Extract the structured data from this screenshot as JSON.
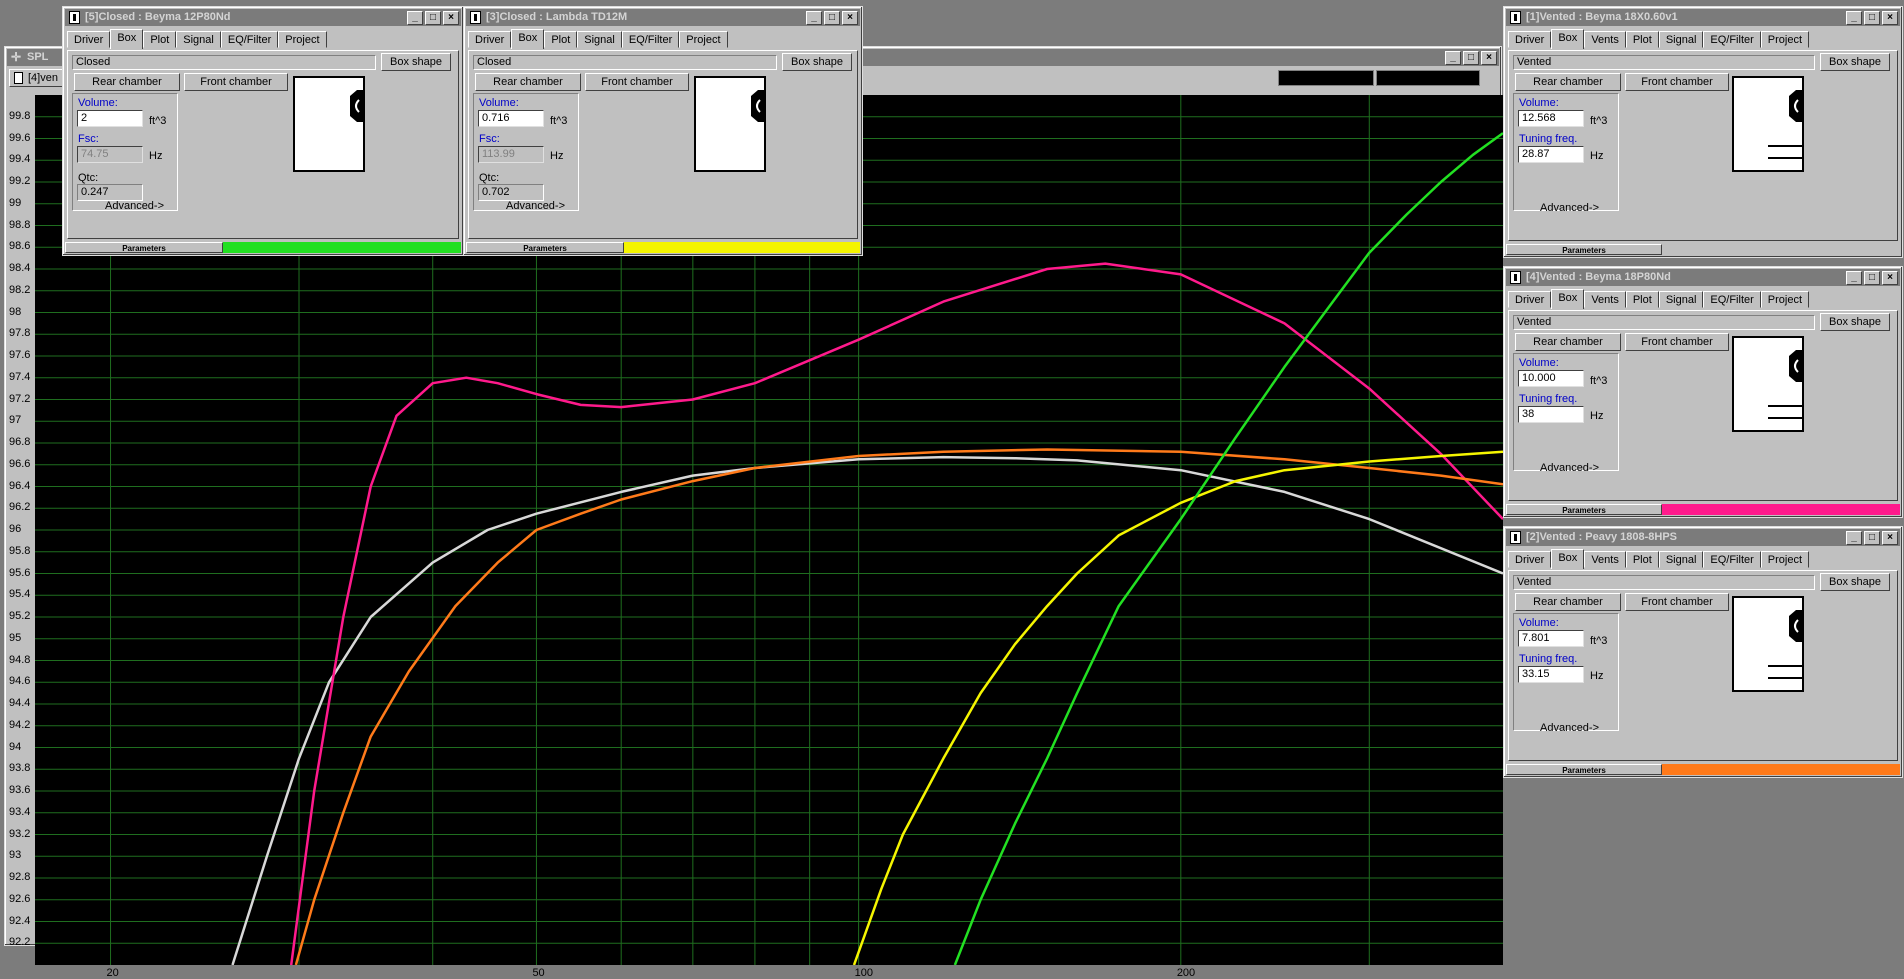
{
  "spl_window": {
    "title": "SPL",
    "tab_label": "[4]ven",
    "window_buttons": [
      "_",
      "□",
      "×"
    ]
  },
  "driver_windows": [
    {
      "id": "w5",
      "title": "[5]Closed : Beyma 12P80Nd",
      "tabs": [
        "Driver",
        "Box",
        "Plot",
        "Signal",
        "EQ/Filter",
        "Project"
      ],
      "active_tab": "Box",
      "box_type": "Closed",
      "box_shape_label": "Box shape",
      "rear_label": "Rear chamber",
      "front_label": "Front chamber",
      "volume_label": "Volume:",
      "volume": "2",
      "volume_unit": "ft^3",
      "f2_label": "Fsc:",
      "f2": "74.75",
      "f2_unit": "Hz",
      "q_label": "Qtc:",
      "q": "0.247",
      "advanced": "Advanced->",
      "status": "Parameters",
      "color": "#22e022"
    },
    {
      "id": "w3",
      "title": "[3]Closed : Lambda TD12M",
      "tabs": [
        "Driver",
        "Box",
        "Plot",
        "Signal",
        "EQ/Filter",
        "Project"
      ],
      "active_tab": "Box",
      "box_type": "Closed",
      "box_shape_label": "Box shape",
      "rear_label": "Rear chamber",
      "front_label": "Front chamber",
      "volume_label": "Volume:",
      "volume": "0.716",
      "volume_unit": "ft^3",
      "f2_label": "Fsc:",
      "f2": "113.99",
      "f2_unit": "Hz",
      "q_label": "Qtc:",
      "q": "0.702",
      "advanced": "Advanced->",
      "status": "Parameters",
      "color": "#f5f500"
    },
    {
      "id": "w1",
      "title": "[1]Vented : Beyma 18X0.60v1",
      "tabs": [
        "Driver",
        "Box",
        "Vents",
        "Plot",
        "Signal",
        "EQ/Filter",
        "Project"
      ],
      "active_tab": "Box",
      "box_type": "Vented",
      "box_shape_label": "Box shape",
      "rear_label": "Rear chamber",
      "front_label": "Front chamber",
      "volume_label": "Volume:",
      "volume": "12.568",
      "volume_unit": "ft^3",
      "f2_label": "Tuning freq.",
      "f2": "28.87",
      "f2_unit": "Hz",
      "advanced": "Advanced->",
      "status": "Parameters",
      "color": "#c0c0c0"
    },
    {
      "id": "w4",
      "title": "[4]Vented : Beyma 18P80Nd",
      "tabs": [
        "Driver",
        "Box",
        "Vents",
        "Plot",
        "Signal",
        "EQ/Filter",
        "Project"
      ],
      "active_tab": "Box",
      "box_type": "Vented",
      "box_shape_label": "Box shape",
      "rear_label": "Rear chamber",
      "front_label": "Front chamber",
      "volume_label": "Volume:",
      "volume": "10.000",
      "volume_unit": "ft^3",
      "f2_label": "Tuning freq.",
      "f2": "38",
      "f2_unit": "Hz",
      "advanced": "Advanced->",
      "status": "Parameters",
      "color": "#ff1a8c"
    },
    {
      "id": "w2",
      "title": "[2]Vented : Peavy 1808-8HPS",
      "tabs": [
        "Driver",
        "Box",
        "Vents",
        "Plot",
        "Signal",
        "EQ/Filter",
        "Project"
      ],
      "active_tab": "Box",
      "box_type": "Vented",
      "box_shape_label": "Box shape",
      "rear_label": "Rear chamber",
      "front_label": "Front chamber",
      "volume_label": "Volume:",
      "volume": "7.801",
      "volume_unit": "ft^3",
      "f2_label": "Tuning freq.",
      "f2": "33.15",
      "f2_unit": "Hz",
      "advanced": "Advanced->",
      "status": "Parameters",
      "color": "#ff7a1a"
    }
  ],
  "chart_data": {
    "type": "line",
    "x_scale": "log",
    "xlim": [
      17,
      400
    ],
    "ylim": [
      92.0,
      100.0
    ],
    "x_tick_labels": [
      20,
      50,
      100,
      200
    ],
    "y_tick_labels": [
      "99.8",
      "99.6",
      "99.4",
      "99.2",
      "99",
      "98.8",
      "98.6",
      "98.4",
      "98.2",
      "98",
      "97.8",
      "97.6",
      "97.4",
      "97.2",
      "97",
      "96.8",
      "96.6",
      "96.4",
      "96.2",
      "96",
      "95.8",
      "95.6",
      "95.4",
      "95.2",
      "95",
      "94.8",
      "94.6",
      "94.4",
      "94.2",
      "94",
      "93.8",
      "93.6",
      "93.4",
      "93.2",
      "93",
      "92.8",
      "92.6",
      "92.4",
      "92.2"
    ],
    "grid": true,
    "background": "#000000",
    "grid_color": "#1f6e1f",
    "series": [
      {
        "color": "#d8d8d8",
        "x": [
          26,
          28,
          30,
          32,
          35,
          40,
          45,
          50,
          60,
          70,
          80,
          100,
          120,
          140,
          160,
          200,
          250,
          300,
          400
        ],
        "y": [
          92.0,
          93.0,
          93.9,
          94.6,
          95.2,
          95.7,
          96.0,
          96.15,
          96.35,
          96.5,
          96.57,
          96.65,
          96.67,
          96.66,
          96.64,
          96.55,
          96.35,
          96.1,
          95.6
        ]
      },
      {
        "color": "#ff1a8c",
        "x": [
          29.5,
          31,
          33,
          35,
          37,
          40,
          43,
          46,
          50,
          55,
          60,
          70,
          80,
          100,
          120,
          150,
          170,
          200,
          250,
          300,
          350,
          400
        ],
        "y": [
          92.0,
          93.6,
          95.2,
          96.4,
          97.05,
          97.35,
          97.4,
          97.35,
          97.25,
          97.15,
          97.13,
          97.2,
          97.35,
          97.75,
          98.1,
          98.4,
          98.45,
          98.35,
          97.9,
          97.3,
          96.7,
          96.1
        ]
      },
      {
        "color": "#ff7a1a",
        "x": [
          29.8,
          31,
          33,
          35,
          38,
          42,
          46,
          50,
          55,
          60,
          70,
          80,
          100,
          120,
          150,
          200,
          250,
          300,
          350,
          400
        ],
        "y": [
          92.0,
          92.6,
          93.4,
          94.1,
          94.7,
          95.3,
          95.7,
          96.0,
          96.15,
          96.28,
          96.45,
          96.57,
          96.68,
          96.72,
          96.74,
          96.72,
          96.65,
          96.57,
          96.5,
          96.42
        ]
      },
      {
        "color": "#f5f500",
        "x": [
          99,
          105,
          110,
          120,
          130,
          140,
          150,
          160,
          175,
          200,
          225,
          250,
          300,
          350,
          400
        ],
        "y": [
          92.0,
          92.7,
          93.2,
          93.9,
          94.5,
          94.95,
          95.3,
          95.6,
          95.95,
          96.25,
          96.45,
          96.55,
          96.63,
          96.68,
          96.72
        ]
      },
      {
        "color": "#22e022",
        "x": [
          123,
          130,
          140,
          150,
          160,
          175,
          200,
          225,
          250,
          275,
          300,
          325,
          350,
          375,
          400
        ],
        "y": [
          92.0,
          92.6,
          93.3,
          93.9,
          94.5,
          95.3,
          96.1,
          96.85,
          97.5,
          98.05,
          98.55,
          98.9,
          99.2,
          99.45,
          99.65
        ]
      }
    ]
  }
}
